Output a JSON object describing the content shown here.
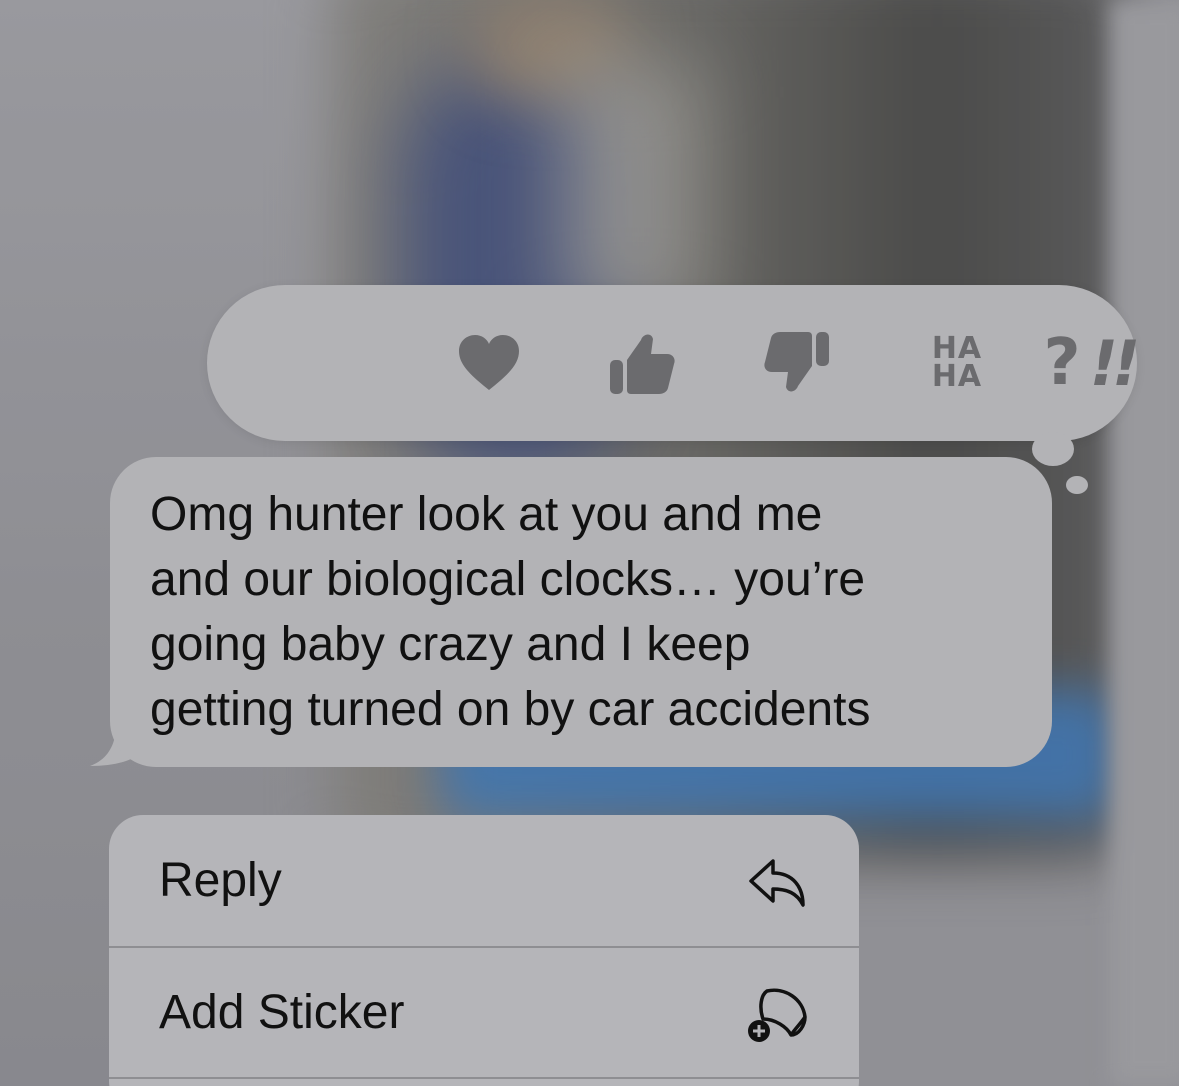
{
  "tapback": {
    "reactions": [
      {
        "name": "heart-icon"
      },
      {
        "name": "thumbs-up-icon"
      },
      {
        "name": "thumbs-down-icon"
      },
      {
        "name": "haha-icon",
        "line1": "HA",
        "line2": "HA"
      },
      {
        "name": "exclamation-icon",
        "glyph": "!!"
      },
      {
        "name": "question-icon",
        "glyph": "?"
      }
    ]
  },
  "message": {
    "lines": [
      "Omg hunter look at you and me",
      "and our biological clocks… you’re",
      "going baby crazy and I keep",
      "getting turned on by car accidents"
    ]
  },
  "menu": {
    "items": [
      {
        "label": "Reply",
        "icon": "reply-arrow-icon"
      },
      {
        "label": "Add Sticker",
        "icon": "add-sticker-icon"
      }
    ]
  },
  "colors": {
    "tapback_bg": "#b3b3b6",
    "icon_gray": "#6b6b6e",
    "bubble_bg": "#b3b3b6",
    "menu_bg": "#b5b5b9",
    "text": "#111111"
  }
}
